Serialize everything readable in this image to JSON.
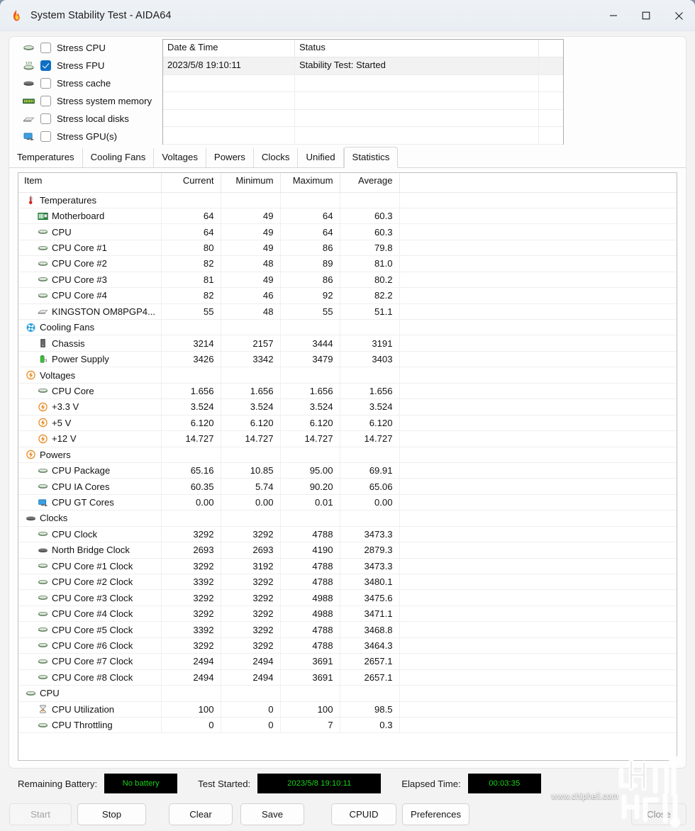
{
  "window": {
    "title": "System Stability Test - AIDA64",
    "app_icon": "flame-icon",
    "minimize": "minimize-icon",
    "maximize": "maximize-icon",
    "close": "close-icon"
  },
  "stress_options": [
    {
      "label": "Stress CPU",
      "checked": false,
      "icon": "cpu-chip-icon"
    },
    {
      "label": "Stress FPU",
      "checked": true,
      "icon": "fpu-chip-icon"
    },
    {
      "label": "Stress cache",
      "checked": false,
      "icon": "cache-chip-icon"
    },
    {
      "label": "Stress system memory",
      "checked": false,
      "icon": "memory-module-icon"
    },
    {
      "label": "Stress local disks",
      "checked": false,
      "icon": "hard-disk-icon"
    },
    {
      "label": "Stress GPU(s)",
      "checked": false,
      "icon": "gpu-monitor-icon"
    }
  ],
  "log": {
    "columns": [
      "Date & Time",
      "Status",
      ""
    ],
    "rows": [
      {
        "datetime": "2023/5/8 19:10:11",
        "status": "Stability Test: Started",
        "selected": true
      },
      {
        "datetime": "",
        "status": "",
        "selected": false
      },
      {
        "datetime": "",
        "status": "",
        "selected": false
      },
      {
        "datetime": "",
        "status": "",
        "selected": false
      },
      {
        "datetime": "",
        "status": "",
        "selected": false
      }
    ]
  },
  "tabs": [
    {
      "label": "Temperatures",
      "active": false
    },
    {
      "label": "Cooling Fans",
      "active": false
    },
    {
      "label": "Voltages",
      "active": false
    },
    {
      "label": "Powers",
      "active": false
    },
    {
      "label": "Clocks",
      "active": false
    },
    {
      "label": "Unified",
      "active": false
    },
    {
      "label": "Statistics",
      "active": true
    }
  ],
  "statistics": {
    "columns": [
      "Item",
      "Current",
      "Minimum",
      "Maximum",
      "Average"
    ],
    "rows": [
      {
        "level": 1,
        "icon": "thermometer-icon",
        "item": "Temperatures",
        "current": "",
        "minimum": "",
        "maximum": "",
        "average": ""
      },
      {
        "level": 2,
        "icon": "motherboard-icon",
        "item": "Motherboard",
        "current": "64",
        "minimum": "49",
        "maximum": "64",
        "average": "60.3"
      },
      {
        "level": 2,
        "icon": "cpu-chip-icon",
        "item": "CPU",
        "current": "64",
        "minimum": "49",
        "maximum": "64",
        "average": "60.3"
      },
      {
        "level": 2,
        "icon": "cpu-chip-icon",
        "item": "CPU Core #1",
        "current": "80",
        "minimum": "49",
        "maximum": "86",
        "average": "79.8"
      },
      {
        "level": 2,
        "icon": "cpu-chip-icon",
        "item": "CPU Core #2",
        "current": "82",
        "minimum": "48",
        "maximum": "89",
        "average": "81.0"
      },
      {
        "level": 2,
        "icon": "cpu-chip-icon",
        "item": "CPU Core #3",
        "current": "81",
        "minimum": "49",
        "maximum": "86",
        "average": "80.2"
      },
      {
        "level": 2,
        "icon": "cpu-chip-icon",
        "item": "CPU Core #4",
        "current": "82",
        "minimum": "46",
        "maximum": "92",
        "average": "82.2"
      },
      {
        "level": 2,
        "icon": "hard-disk-icon",
        "item": "KINGSTON OM8PGP4...",
        "current": "55",
        "minimum": "48",
        "maximum": "55",
        "average": "51.1"
      },
      {
        "level": 1,
        "icon": "fan-icon",
        "item": "Cooling Fans",
        "current": "",
        "minimum": "",
        "maximum": "",
        "average": ""
      },
      {
        "level": 2,
        "icon": "chassis-icon",
        "item": "Chassis",
        "current": "3214",
        "minimum": "2157",
        "maximum": "3444",
        "average": "3191"
      },
      {
        "level": 2,
        "icon": "power-supply-icon",
        "item": "Power Supply",
        "current": "3426",
        "minimum": "3342",
        "maximum": "3479",
        "average": "3403"
      },
      {
        "level": 1,
        "icon": "voltage-bolt-icon",
        "item": "Voltages",
        "current": "",
        "minimum": "",
        "maximum": "",
        "average": ""
      },
      {
        "level": 2,
        "icon": "cpu-chip-icon",
        "item": "CPU Core",
        "current": "1.656",
        "minimum": "1.656",
        "maximum": "1.656",
        "average": "1.656"
      },
      {
        "level": 2,
        "icon": "voltage-bolt-icon",
        "item": "+3.3 V",
        "current": "3.524",
        "minimum": "3.524",
        "maximum": "3.524",
        "average": "3.524"
      },
      {
        "level": 2,
        "icon": "voltage-bolt-icon",
        "item": "+5 V",
        "current": "6.120",
        "minimum": "6.120",
        "maximum": "6.120",
        "average": "6.120"
      },
      {
        "level": 2,
        "icon": "voltage-bolt-icon",
        "item": "+12 V",
        "current": "14.727",
        "minimum": "14.727",
        "maximum": "14.727",
        "average": "14.727"
      },
      {
        "level": 1,
        "icon": "voltage-bolt-icon",
        "item": "Powers",
        "current": "",
        "minimum": "",
        "maximum": "",
        "average": ""
      },
      {
        "level": 2,
        "icon": "cpu-chip-icon",
        "item": "CPU Package",
        "current": "65.16",
        "minimum": "10.85",
        "maximum": "95.00",
        "average": "69.91"
      },
      {
        "level": 2,
        "icon": "cpu-chip-icon",
        "item": "CPU IA Cores",
        "current": "60.35",
        "minimum": "5.74",
        "maximum": "90.20",
        "average": "65.06"
      },
      {
        "level": 2,
        "icon": "gpu-monitor-icon",
        "item": "CPU GT Cores",
        "current": "0.00",
        "minimum": "0.00",
        "maximum": "0.01",
        "average": "0.00"
      },
      {
        "level": 1,
        "icon": "cache-chip-icon",
        "item": "Clocks",
        "current": "",
        "minimum": "",
        "maximum": "",
        "average": ""
      },
      {
        "level": 2,
        "icon": "cpu-chip-icon",
        "item": "CPU Clock",
        "current": "3292",
        "minimum": "3292",
        "maximum": "4788",
        "average": "3473.3"
      },
      {
        "level": 2,
        "icon": "cache-chip-icon",
        "item": "North Bridge Clock",
        "current": "2693",
        "minimum": "2693",
        "maximum": "4190",
        "average": "2879.3"
      },
      {
        "level": 2,
        "icon": "cpu-chip-icon",
        "item": "CPU Core #1 Clock",
        "current": "3292",
        "minimum": "3192",
        "maximum": "4788",
        "average": "3473.3"
      },
      {
        "level": 2,
        "icon": "cpu-chip-icon",
        "item": "CPU Core #2 Clock",
        "current": "3392",
        "minimum": "3292",
        "maximum": "4788",
        "average": "3480.1"
      },
      {
        "level": 2,
        "icon": "cpu-chip-icon",
        "item": "CPU Core #3 Clock",
        "current": "3292",
        "minimum": "3292",
        "maximum": "4988",
        "average": "3475.6"
      },
      {
        "level": 2,
        "icon": "cpu-chip-icon",
        "item": "CPU Core #4 Clock",
        "current": "3292",
        "minimum": "3292",
        "maximum": "4988",
        "average": "3471.1"
      },
      {
        "level": 2,
        "icon": "cpu-chip-icon",
        "item": "CPU Core #5 Clock",
        "current": "3392",
        "minimum": "3292",
        "maximum": "4788",
        "average": "3468.8"
      },
      {
        "level": 2,
        "icon": "cpu-chip-icon",
        "item": "CPU Core #6 Clock",
        "current": "3292",
        "minimum": "3292",
        "maximum": "4788",
        "average": "3464.3"
      },
      {
        "level": 2,
        "icon": "cpu-chip-icon",
        "item": "CPU Core #7 Clock",
        "current": "2494",
        "minimum": "2494",
        "maximum": "3691",
        "average": "2657.1"
      },
      {
        "level": 2,
        "icon": "cpu-chip-icon",
        "item": "CPU Core #8 Clock",
        "current": "2494",
        "minimum": "2494",
        "maximum": "3691",
        "average": "2657.1"
      },
      {
        "level": 1,
        "icon": "cpu-chip-icon",
        "item": "CPU",
        "current": "",
        "minimum": "",
        "maximum": "",
        "average": ""
      },
      {
        "level": 2,
        "icon": "hourglass-icon",
        "item": "CPU Utilization",
        "current": "100",
        "minimum": "0",
        "maximum": "100",
        "average": "98.5"
      },
      {
        "level": 2,
        "icon": "cpu-chip-icon",
        "item": "CPU Throttling",
        "current": "0",
        "minimum": "0",
        "maximum": "7",
        "average": "0.3"
      }
    ]
  },
  "statusbar": {
    "battery_label": "Remaining Battery:",
    "battery_value": "No battery",
    "started_label": "Test Started:",
    "started_value": "2023/5/8 19:10:11",
    "elapsed_label": "Elapsed Time:",
    "elapsed_value": "00:03:35",
    "led_color": "#19d219",
    "led_bg": "#000000"
  },
  "buttons": [
    {
      "label": "Start",
      "disabled": true
    },
    {
      "label": "Stop",
      "disabled": false
    },
    {
      "label": "Clear",
      "disabled": false
    },
    {
      "label": "Save",
      "disabled": false
    },
    {
      "label": "CPUID",
      "disabled": false
    },
    {
      "label": "Preferences",
      "disabled": false
    },
    {
      "label": "Close",
      "disabled": false
    }
  ],
  "watermark": {
    "url": "www.chiphell.com",
    "logo": "chiphell-logo"
  }
}
